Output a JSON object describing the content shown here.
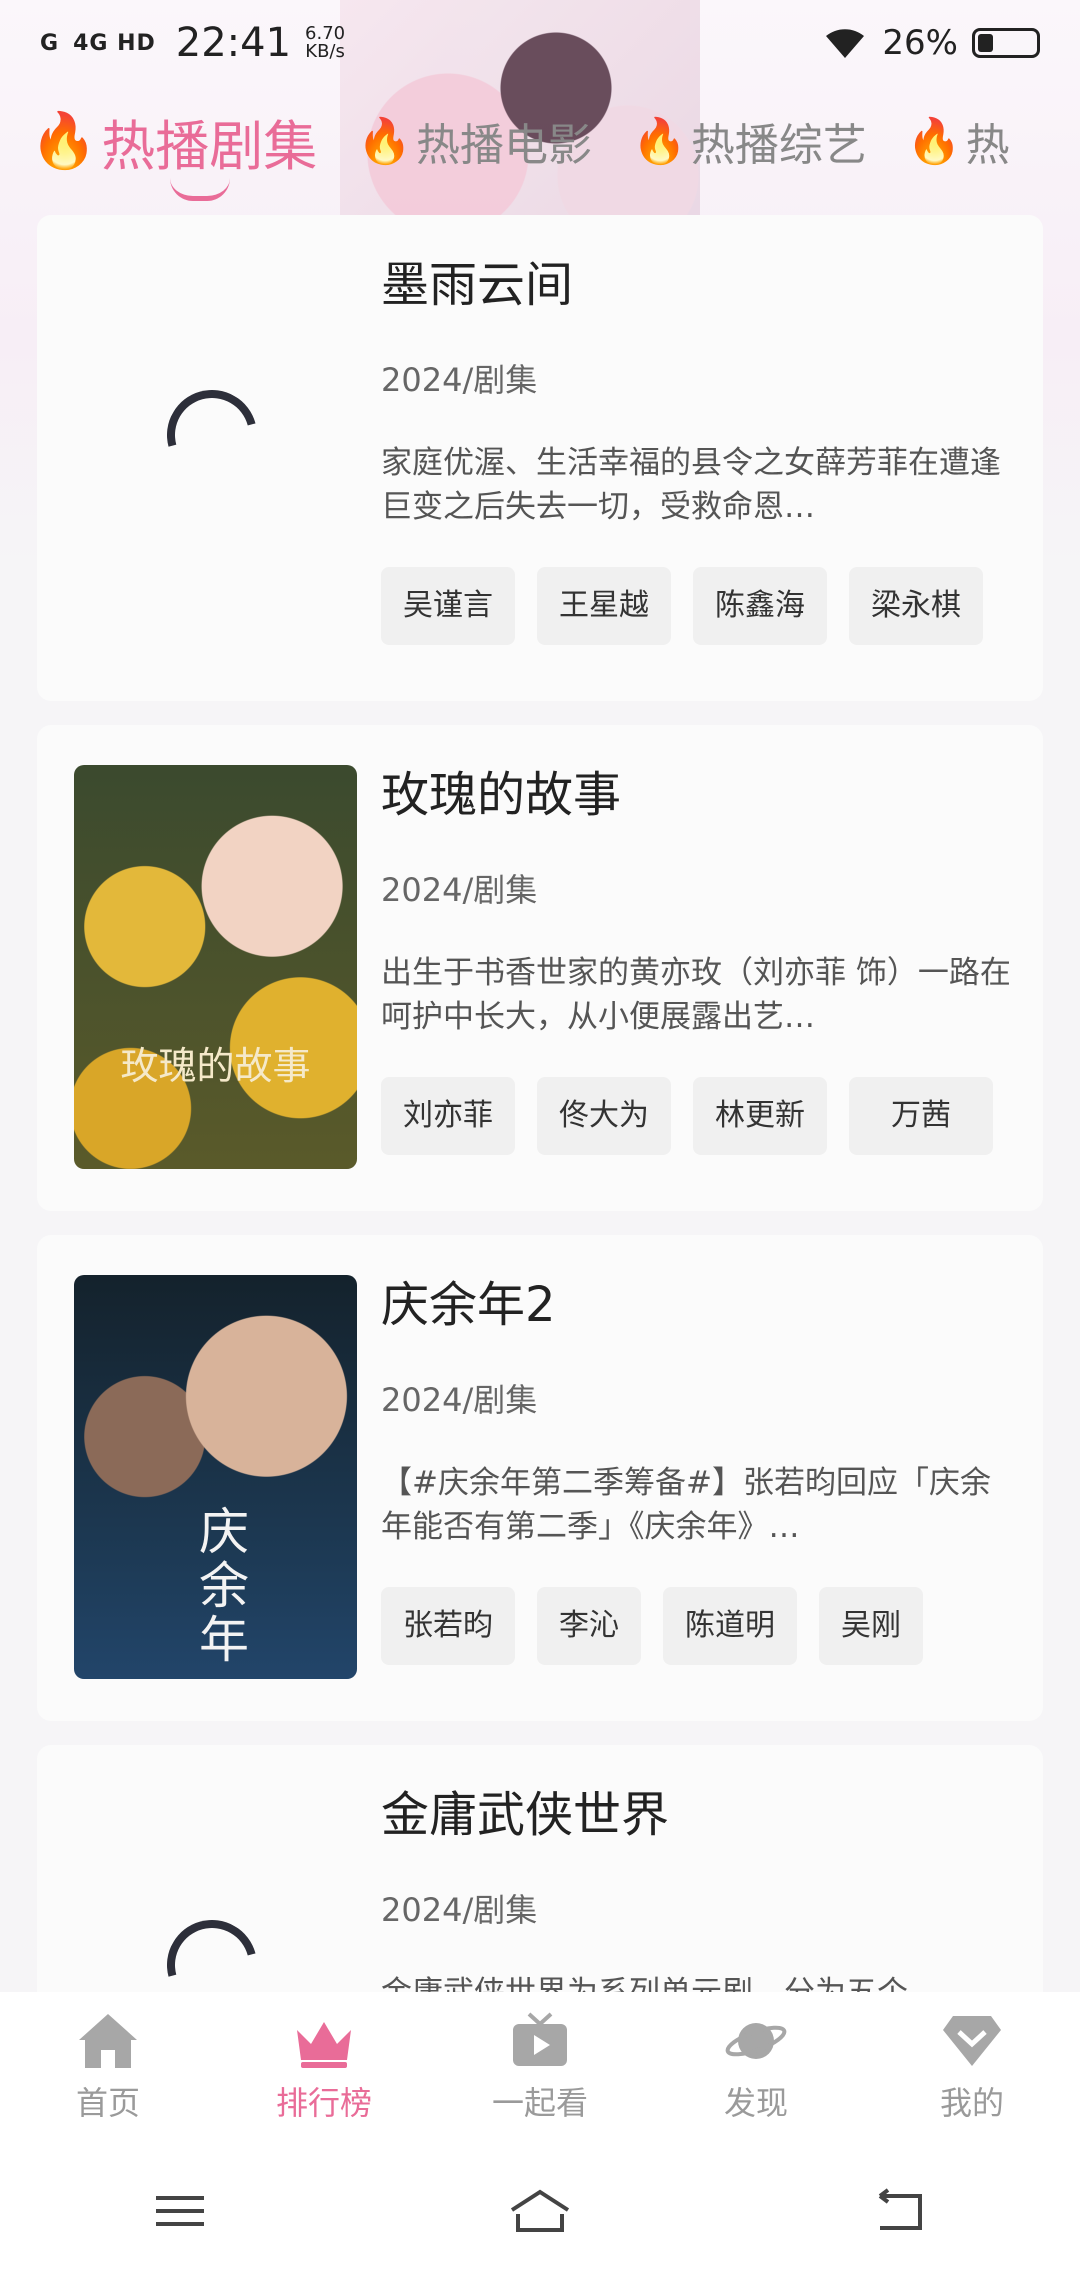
{
  "status_bar": {
    "signal1": "G",
    "signal2": "4G HD",
    "time": "22:41",
    "speed_value": "6.70",
    "speed_unit": "KB/s",
    "battery_percent": "26%",
    "battery_level": 0.26
  },
  "tabs": [
    {
      "label": "热播剧集",
      "active": true
    },
    {
      "label": "热播电影",
      "active": false
    },
    {
      "label": "热播综艺",
      "active": false
    },
    {
      "label": "热",
      "active": false
    }
  ],
  "cards": [
    {
      "title": "墨雨云间",
      "meta": "2024/剧集",
      "desc": "家庭优渥、生活幸福的县令之女薛芳菲在遭逢巨变之后失去一切，受救命恩…",
      "actors": [
        "吴谨言",
        "王星越",
        "陈鑫海",
        "梁永棋"
      ],
      "poster": "loading"
    },
    {
      "title": "玫瑰的故事",
      "meta": "2024/剧集",
      "desc": "出生于书香世家的黄亦玫（刘亦菲 饰）一路在呵护中长大，从小便展露出艺…",
      "actors": [
        "刘亦菲",
        "佟大为",
        "林更新",
        "万茜"
      ],
      "poster": "rose",
      "poster_text": "玫瑰的故事"
    },
    {
      "title": "庆余年2",
      "meta": "2024/剧集",
      "desc": "【#庆余年第二季筹备#】张若昀回应「庆余年能否有第二季」《庆余年》…",
      "actors": [
        "张若昀",
        "李沁",
        "陈道明",
        "吴刚"
      ],
      "poster": "qyn",
      "poster_text": "庆余年"
    },
    {
      "title": "金庸武侠世界",
      "meta": "2024/剧集",
      "desc": "金庸武侠世界为系列单元剧，分为五个…",
      "actors": [],
      "poster": "loading"
    }
  ],
  "bottom_nav": [
    {
      "label": "首页",
      "icon": "home-icon",
      "active": false
    },
    {
      "label": "排行榜",
      "icon": "crown-icon",
      "active": true
    },
    {
      "label": "一起看",
      "icon": "tv-play-icon",
      "active": false
    },
    {
      "label": "发现",
      "icon": "planet-icon",
      "active": false
    },
    {
      "label": "我的",
      "icon": "heart-badge-icon",
      "active": false
    }
  ],
  "colors": {
    "accent": "#e96c98",
    "inactive": "#9a9a9a",
    "fire": "#ff6a1a"
  }
}
